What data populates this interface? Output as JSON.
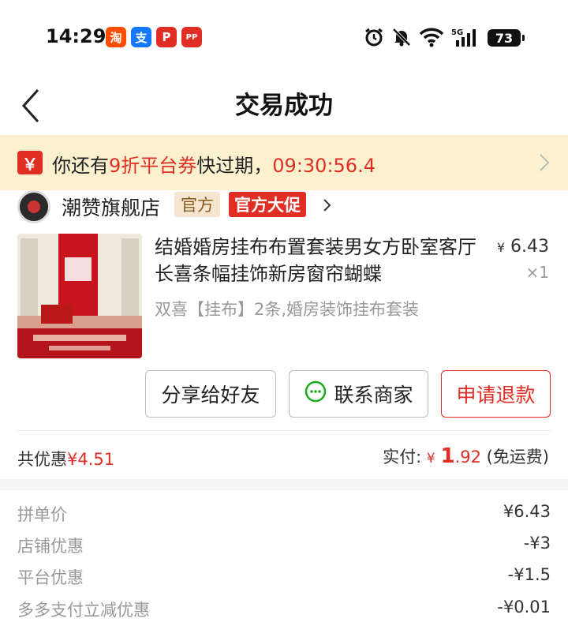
{
  "status_bar": {
    "time": "14:29",
    "battery": "73",
    "network": "5G",
    "app_icons": [
      "淘",
      "支",
      "P",
      "PP"
    ]
  },
  "header": {
    "title": "交易成功"
  },
  "coupon_banner": {
    "text_before": "你还有",
    "highlight": "9折平台券",
    "text_after": "快过期，",
    "countdown": "09:30:56.4"
  },
  "shop": {
    "name": "潮赞旗舰店",
    "tag_official": "官方",
    "tag_promo": "官方大促"
  },
  "product": {
    "title": "结婚婚房挂布布置套装男女方卧室客厅长喜条幅挂饰新房窗帘蝴蝶",
    "spec": "双喜【挂布】2条,婚房装饰挂布套装",
    "currency": "¥",
    "price": "6.43",
    "quantity": "×1"
  },
  "actions": {
    "share": "分享给好友",
    "contact": "联系商家",
    "refund": "申请退款"
  },
  "totals": {
    "discount_label": "共优惠",
    "discount_value": "¥4.51",
    "paid_label": "实付: ",
    "paid_currency": "¥",
    "paid_int": "1",
    "paid_dec": ".92",
    "shipping": " (免运费)"
  },
  "breakdown": [
    {
      "label": "拼单价",
      "value": "¥6.43"
    },
    {
      "label": "店铺优惠",
      "value": "-¥3"
    },
    {
      "label": "平台优惠",
      "value": "-¥1.5"
    },
    {
      "label": "多多支付立减优惠",
      "value": "-¥0.01"
    }
  ],
  "colors": {
    "accent": "#e02e24",
    "banner_bg": "#fbf1cf",
    "muted": "#999999"
  }
}
